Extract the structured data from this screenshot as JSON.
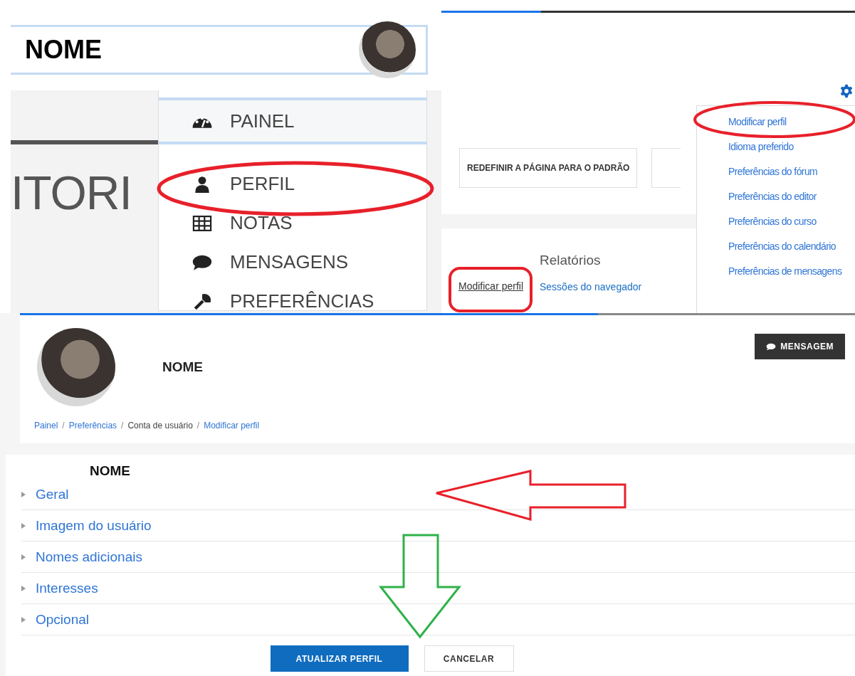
{
  "user_menu_panel": {
    "user_name": "NOME",
    "page_title_fragment": "ITORI",
    "menu_items": [
      {
        "label": "PAINEL",
        "selected": true
      },
      {
        "label": "PERFIL",
        "selected": false
      },
      {
        "label": "NOTAS",
        "selected": false
      },
      {
        "label": "MENSAGENS",
        "selected": false
      },
      {
        "label": "PREFERÊNCIAS",
        "selected": false
      }
    ]
  },
  "preferences_panel": {
    "reset_button": "REDEFINIR A PÁGINA PARA O PADRÃO",
    "account_link": "Modificar perfil",
    "reports_heading": "Relatórios",
    "reports_link": "Sessões do navegador",
    "settings_menu": [
      "Modificar perfil",
      "Idioma preferido",
      "Preferências do fórum",
      "Preferências do editor",
      "Preferências do curso",
      "Preferências do calendário",
      "Preferências de mensagens"
    ]
  },
  "edit_profile_panel": {
    "user_name": "NOME",
    "message_button": "MENSAGEM",
    "breadcrumb": [
      {
        "label": "Painel",
        "link": true
      },
      {
        "label": "Preferências",
        "link": true
      },
      {
        "label": "Conta de usuário",
        "link": false
      },
      {
        "label": "Modificar perfil",
        "link": true
      }
    ],
    "breadcrumb_separator": "/",
    "form_title": "NOME",
    "sections": [
      {
        "label": "Geral",
        "expanded": false
      },
      {
        "label": "Imagem do usuário",
        "expanded": false
      },
      {
        "label": "Nomes adicionais",
        "expanded": false
      },
      {
        "label": "Interesses",
        "expanded": false
      },
      {
        "label": "Opcional",
        "expanded": false
      }
    ],
    "buttons": [
      {
        "label": "ATUALIZAR PERFIL",
        "kind": "primary"
      },
      {
        "label": "CANCELAR",
        "kind": "secondary"
      }
    ]
  }
}
